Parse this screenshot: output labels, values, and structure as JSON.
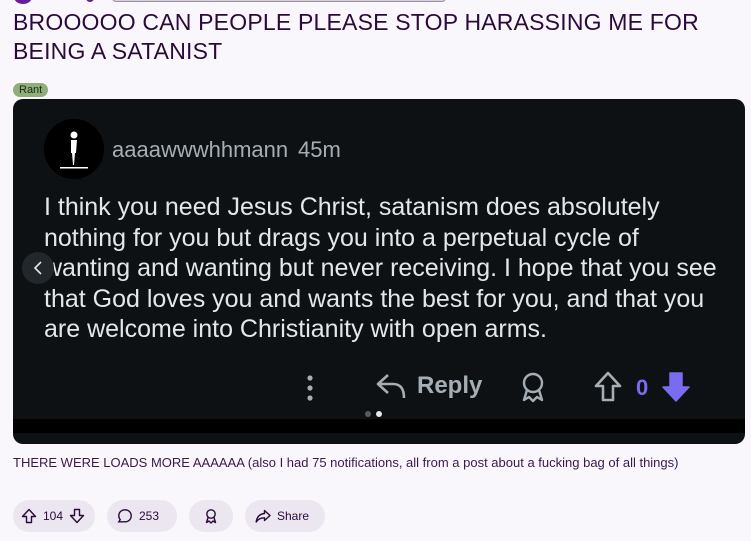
{
  "post": {
    "title": "BROOOOO CAN PEOPLE PLEASE STOP HARASSING ME FOR BEING A SATANIST",
    "flair": "Rant",
    "caption": "THERE WERE LOADS MORE AAAAAA (also I had 75 notifications, all from a post about a fucking bag of all things)"
  },
  "gallery": {
    "current_page": 2,
    "total_pages": 2,
    "comment": {
      "username": "aaaawwwhhmann",
      "time_ago": "45m",
      "text": "I think you need Jesus Christ, satanism does absolutely nothing for you but drags you into a perpetual cycle of wanting and wanting but never receiving. I hope that you see that God loves you and wants the best for you, and that you are welcome into Christianity with open arms.",
      "reply_label": "Reply",
      "vote_count": "0"
    }
  },
  "actions": {
    "upvotes": "104",
    "comments": "253",
    "share_label": "Share"
  },
  "colors": {
    "accent": "#7a6cf0",
    "flair_bg": "#8fae7a",
    "dark_bg": "#0e1113"
  },
  "icons": [
    "more-vertical-icon",
    "reply-icon",
    "award-icon",
    "upvote-icon",
    "downvote-icon",
    "comment-icon",
    "share-icon",
    "chevron-left-icon"
  ]
}
